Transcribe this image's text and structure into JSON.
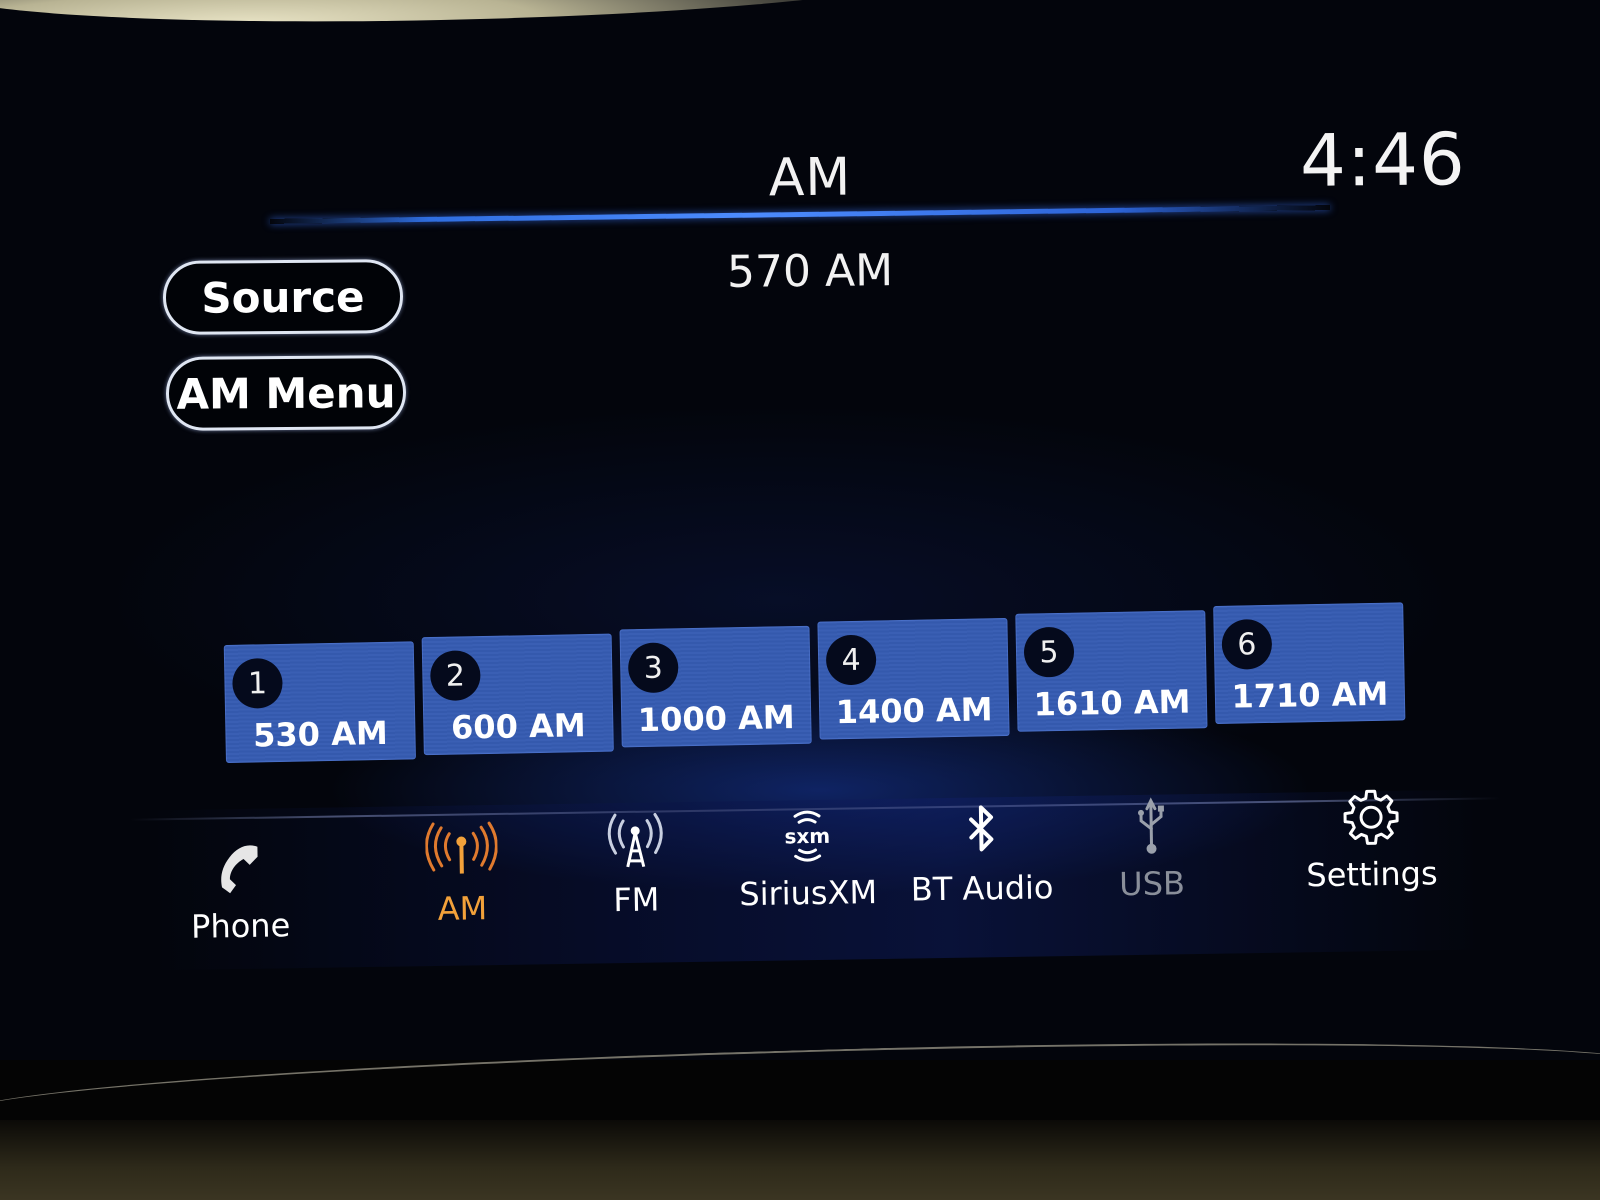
{
  "header": {
    "title": "AM",
    "clock": "4:46"
  },
  "now_playing": {
    "station": "570 AM"
  },
  "buttons": {
    "source": "Source",
    "menu": "AM Menu"
  },
  "presets": [
    {
      "number": "1",
      "frequency": "530 AM"
    },
    {
      "number": "2",
      "frequency": "600 AM"
    },
    {
      "number": "3",
      "frequency": "1000 AM"
    },
    {
      "number": "4",
      "frequency": "1400 AM"
    },
    {
      "number": "5",
      "frequency": "1610 AM"
    },
    {
      "number": "6",
      "frequency": "1710 AM"
    }
  ],
  "nav": {
    "items": [
      {
        "label": "Phone",
        "icon": "phone-icon",
        "state": "normal"
      },
      {
        "label": "AM",
        "icon": "am-antenna-icon",
        "state": "active"
      },
      {
        "label": "FM",
        "icon": "fm-tower-icon",
        "state": "normal"
      },
      {
        "label": "SiriusXM",
        "icon": "siriusxm-icon",
        "icon_text": "sxm",
        "state": "normal"
      },
      {
        "label": "BT Audio",
        "icon": "bluetooth-icon",
        "state": "normal"
      },
      {
        "label": "USB",
        "icon": "usb-icon",
        "state": "disabled"
      },
      {
        "label": "Settings",
        "icon": "gear-icon",
        "state": "normal"
      }
    ]
  },
  "colors": {
    "active_accent": "#f2a13a",
    "preset_blue": "#3a5fb4",
    "header_rule": "#4d8cff",
    "disabled_text": "#8a8f9a"
  }
}
